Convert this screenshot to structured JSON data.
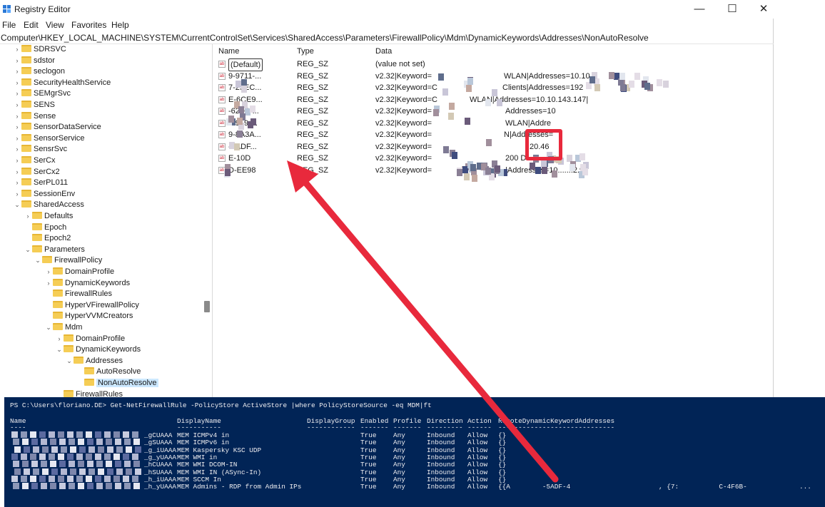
{
  "window": {
    "title": "Registry Editor",
    "minimize_glyph": "—",
    "maximize_glyph": "☐",
    "close_glyph": "✕"
  },
  "menu": [
    "File",
    "Edit",
    "View",
    "Favorites",
    "Help"
  ],
  "address": "Computer\\HKEY_LOCAL_MACHINE\\SYSTEM\\CurrentControlSet\\Services\\SharedAccess\\Parameters\\FirewallPolicy\\Mdm\\DynamicKeywords\\Addresses\\NonAutoResolve",
  "tree": [
    {
      "label": "SDRSVC",
      "chev": "›"
    },
    {
      "label": "sdstor",
      "chev": "›"
    },
    {
      "label": "seclogon",
      "chev": "›"
    },
    {
      "label": "SecurityHealthService",
      "chev": "›"
    },
    {
      "label": "SEMgrSvc",
      "chev": "›"
    },
    {
      "label": "SENS",
      "chev": "›"
    },
    {
      "label": "Sense",
      "chev": "›"
    },
    {
      "label": "SensorDataService",
      "chev": "›"
    },
    {
      "label": "SensorService",
      "chev": "›"
    },
    {
      "label": "SensrSvc",
      "chev": "›"
    },
    {
      "label": "SerCx",
      "chev": "›"
    },
    {
      "label": "SerCx2",
      "chev": "›"
    },
    {
      "label": "SerPL011",
      "chev": "›"
    },
    {
      "label": "SessionEnv",
      "chev": "›"
    },
    {
      "label": "SharedAccess",
      "chev": "⌄"
    },
    {
      "label": "Defaults",
      "chev": "›"
    },
    {
      "label": "Epoch",
      "chev": ""
    },
    {
      "label": "Epoch2",
      "chev": ""
    },
    {
      "label": "Parameters",
      "chev": "⌄"
    },
    {
      "label": "FirewallPolicy",
      "chev": "⌄"
    },
    {
      "label": "DomainProfile",
      "chev": "›"
    },
    {
      "label": "DynamicKeywords",
      "chev": "›"
    },
    {
      "label": "FirewallRules",
      "chev": ""
    },
    {
      "label": "HyperVFirewallPolicy",
      "chev": ""
    },
    {
      "label": "HyperVVMCreators",
      "chev": ""
    },
    {
      "label": "Mdm",
      "chev": "⌄"
    },
    {
      "label": "DomainProfile",
      "chev": "›"
    },
    {
      "label": "DynamicKeywords",
      "chev": "⌄"
    },
    {
      "label": "Addresses",
      "chev": "⌄"
    },
    {
      "label": "AutoResolve",
      "chev": ""
    },
    {
      "label": "NonAutoResolve",
      "chev": ""
    },
    {
      "label": "FirewallRules",
      "chev": ""
    }
  ],
  "columns": {
    "name": "Name",
    "type": "Type",
    "data": "Data"
  },
  "values": [
    {
      "name": "(Default)",
      "type": "REG_SZ",
      "data": "(value not set)"
    },
    {
      "name": "9-9711-...",
      "type": "REG_SZ",
      "data": "v2.32|Keyword=",
      "tail": "WLAN|Addresses=10.10"
    },
    {
      "name": "7-25EC...",
      "type": "REG_SZ",
      "data": "v2.32|Keyword=C",
      "tail": "Clients|Addresses=192"
    },
    {
      "name": "E-6CE9...",
      "type": "REG_SZ",
      "data": "v2.32|Keyword=C",
      "tail": "WLAN|Addresses=10.10.143.147|"
    },
    {
      "name": "-626C-...",
      "type": "REG_SZ",
      "data": "v2.32|Keyword=",
      "tail": "Addresses=10"
    },
    {
      "name": "-6919-...",
      "type": "REG_SZ",
      "data": "v2.32|Keyword=",
      "tail": "WLAN|Addre"
    },
    {
      "name": "9-8A3A...",
      "type": "REG_SZ",
      "data": "v2.32|Keyword=",
      "tail": "N|Addresses="
    },
    {
      "name": "-5ADF...",
      "type": "REG_SZ",
      "data": "v2.32|Keyword=",
      "tail": "20.46"
    },
    {
      "name": "E-10D",
      "type": "REG_SZ",
      "data": "v2.32|Keyword=",
      "tail": "200 D"
    },
    {
      "name": "D-EE98",
      "type": "REG_SZ",
      "data": "v2.32|Keyword=",
      "tail": "|Addresses=10.......2.9|"
    }
  ],
  "powershell": {
    "command": "PS C:\\Users\\floriano.DE> Get-NetFirewallRule -PolicyStore ActiveStore |where PolicyStoreSource -eq MDM|ft",
    "headers": [
      "Name",
      "DisplayName",
      "DisplayGroup",
      "Enabled",
      "Profile",
      "Direction",
      "Action",
      "RemoteDynamicKeywordAddresses"
    ],
    "dashes": [
      "----",
      "-----------",
      "------------",
      "-------",
      "-------",
      "---------",
      "------",
      "-----------------------------"
    ],
    "rows": [
      {
        "name": "_gCUAAA",
        "display": "MEM ICMPv4 in",
        "enabled": "True",
        "profile": "Any",
        "direction": "Inbound",
        "action": "Allow",
        "remote": "{}"
      },
      {
        "name": "_gSUAAA",
        "display": "MEM ICMPv6 in",
        "enabled": "True",
        "profile": "Any",
        "direction": "Inbound",
        "action": "Allow",
        "remote": "{}"
      },
      {
        "name": "_g_iUAAA",
        "display": "MEM Kaspersky KSC UDP",
        "enabled": "True",
        "profile": "Any",
        "direction": "Inbound",
        "action": "Allow",
        "remote": "{}"
      },
      {
        "name": "_g_yUAAA",
        "display": "MEM WMI in",
        "enabled": "True",
        "profile": "Any",
        "direction": "Inbound",
        "action": "Allow",
        "remote": "{}"
      },
      {
        "name": "_hCUAAA",
        "display": "MEM WMI DCOM-IN",
        "enabled": "True",
        "profile": "Any",
        "direction": "Inbound",
        "action": "Allow",
        "remote": "{}"
      },
      {
        "name": "_hSUAAA",
        "display": "MEM WMI IN (ASync-In)",
        "enabled": "True",
        "profile": "Any",
        "direction": "Inbound",
        "action": "Allow",
        "remote": "{}"
      },
      {
        "name": "_h_iUAAA",
        "display": "MEM SCCM In",
        "enabled": "True",
        "profile": "Any",
        "direction": "Inbound",
        "action": "Allow",
        "remote": "{}"
      },
      {
        "name": "_h_yUAAA",
        "display": "MEM Admins - RDP from Admin IPs",
        "enabled": "True",
        "profile": "Any",
        "direction": "Inbound",
        "action": "Allow",
        "remote": "{{A        -5ADF-4                      , {7:          C-4F6B-             ..."
      }
    ]
  },
  "colors": {
    "ps_background": "#012456",
    "arrow": "#e8293c",
    "folder": "#f5cd55",
    "selection": "#cce8ff"
  }
}
